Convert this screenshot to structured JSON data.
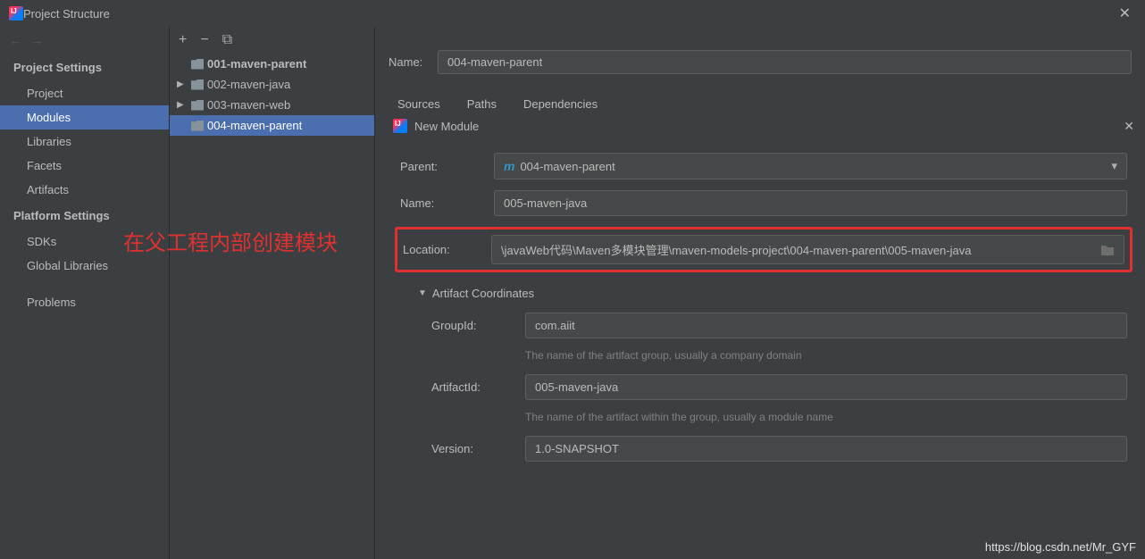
{
  "titlebar": {
    "title": "Project Structure"
  },
  "leftPanel": {
    "sections": [
      {
        "header": "Project Settings",
        "items": [
          "Project",
          "Modules",
          "Libraries",
          "Facets",
          "Artifacts"
        ],
        "selectedIndex": 1
      },
      {
        "header": "Platform Settings",
        "items": [
          "SDKs",
          "Global Libraries"
        ]
      },
      {
        "header": "",
        "items": [
          "Problems"
        ]
      }
    ]
  },
  "middlePanel": {
    "treeItems": [
      {
        "label": "001-maven-parent",
        "bold": true,
        "expanded": false
      },
      {
        "label": "002-maven-java",
        "bold": false,
        "expanded": false,
        "hasExpander": true
      },
      {
        "label": "003-maven-web",
        "bold": false,
        "expanded": false,
        "hasExpander": true
      },
      {
        "label": "004-maven-parent",
        "bold": false,
        "expanded": false,
        "selected": true
      }
    ]
  },
  "rightPanel": {
    "nameLabel": "Name:",
    "nameValue": "004-maven-parent",
    "tabs": [
      "Sources",
      "Paths",
      "Dependencies"
    ]
  },
  "dialog": {
    "title": "New Module",
    "parentLabel": "Parent:",
    "parentValue": "004-maven-parent",
    "nameLabel": "Name:",
    "nameValue": "005-maven-java",
    "locationLabel": "Location:",
    "locationValue": "\\javaWeb代码\\Maven多模块管理\\maven-models-project\\004-maven-parent\\005-maven-java",
    "artifactCoordinates": "Artifact Coordinates",
    "groupIdLabel": "GroupId:",
    "groupIdValue": "com.aiit",
    "groupIdHint": "The name of the artifact group, usually a company domain",
    "artifactIdLabel": "ArtifactId:",
    "artifactIdValue": "005-maven-java",
    "artifactIdHint": "The name of the artifact within the group, usually a module name",
    "versionLabel": "Version:",
    "versionValue": "1.0-SNAPSHOT"
  },
  "annotation": "在父工程内部创建模块",
  "watermark": "https://blog.csdn.net/Mr_GYF"
}
